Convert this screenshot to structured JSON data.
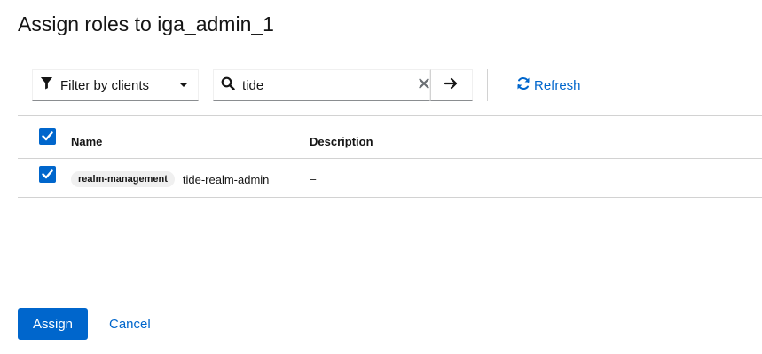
{
  "modal": {
    "title": "Assign roles to iga_admin_1"
  },
  "toolbar": {
    "filter_label": "Filter by clients",
    "search_value": "tide",
    "refresh_label": "Refresh"
  },
  "table": {
    "columns": [
      "Name",
      "Description"
    ],
    "header_checked": true,
    "rows": [
      {
        "checked": true,
        "client_badge": "realm-management",
        "role_name": "tide-realm-admin",
        "description": "–"
      }
    ]
  },
  "footer": {
    "assign_label": "Assign",
    "cancel_label": "Cancel"
  },
  "colors": {
    "primary": "#0066cc",
    "border": "#d2d2d2",
    "badge_bg": "#f0f0f0"
  }
}
